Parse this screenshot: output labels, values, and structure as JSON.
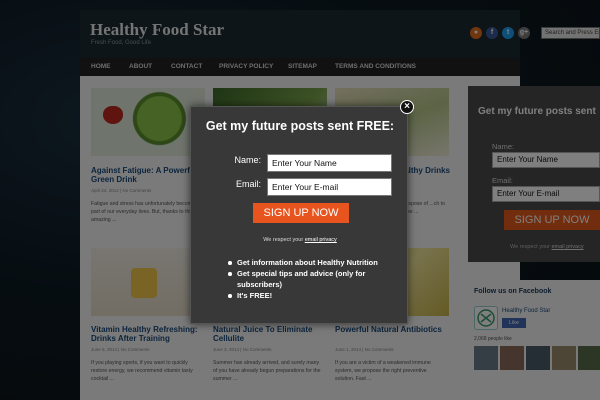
{
  "site": {
    "title": "Healthy Food Star",
    "tagline": "Fresh Food, Good Life",
    "search_placeholder": "Search and Press Enter",
    "social_icons": [
      {
        "name": "rss-icon",
        "glyph": "●",
        "color": "#e46c1e"
      },
      {
        "name": "facebook-icon",
        "glyph": "f",
        "color": "#3b5998"
      },
      {
        "name": "twitter-icon",
        "glyph": "t",
        "color": "#1da1f2"
      },
      {
        "name": "google-plus-icon",
        "glyph": "g+",
        "color": "#7a7a7a"
      }
    ]
  },
  "nav": {
    "items": [
      "HOME",
      "ABOUT",
      "CONTACT",
      "PRIVACY POLICY",
      "SITEMAP",
      "TERMS AND CONDITIONS"
    ]
  },
  "posts": [
    {
      "title": "Against Fatigue: A Powerful Green Drink",
      "meta": "April 24, 2014  |  No Comments",
      "excerpt": "Fatigue and stress has unfortunately become part of our everyday lives. But, thanks to this amazing ..."
    },
    {
      "title": "Natural Juice To Eliminate",
      "meta": "",
      "excerpt": ""
    },
    {
      "title": "Healthy Drinks",
      "meta": "",
      "excerpt": "...dispose of ...ch to make ..."
    },
    {
      "title": "Vitamin Healthy Refreshing: Drinks After Training",
      "meta": "June 5, 2014  |  No Comments",
      "excerpt": "If you playing sports, if you want to quickly restore energy, we recommend vitamin tasty cocktail ..."
    },
    {
      "title": "Natural Juice To Eliminate Cellulite",
      "meta": "June 3, 2014  |  No Comments",
      "excerpt": "Summer has already arrived, and surely many of you have already begun preparations for the summer ..."
    },
    {
      "title": "Powerful Natural Antibiotics",
      "meta": "June 1, 2014  |  No Comments",
      "excerpt": "If you are a victim of a weakened immune system, we propose the right preventive solution. Fast ..."
    }
  ],
  "sidebar": {
    "title": "Get my future posts sent",
    "name_label": "Name:",
    "name_placeholder": "Enter Your Name",
    "email_label": "Email:",
    "email_placeholder": "Enter Your E-mail",
    "button": "SIGN UP NOW",
    "note_prefix": "We respect your ",
    "note_link": "email privacy"
  },
  "facebook": {
    "title": "Follow us on Facebook",
    "page_name": "Healthy Food Star",
    "like_label": "Like",
    "count": "2,068 people like"
  },
  "popup": {
    "title": "Get my future posts sent FREE:",
    "close_glyph": "×",
    "name_label": "Name:",
    "name_placeholder": "Enter Your Name",
    "email_label": "Email:",
    "email_placeholder": "Enter Your E-mail",
    "button": "SIGN UP NOW",
    "note_prefix": "We respect your ",
    "note_link": "email privacy",
    "benefits": [
      "Get information about Healthy Nutrition",
      "Get special tips and advice (only for subscribers)",
      "It's FREE!"
    ]
  },
  "colors": {
    "accent": "#e8541e",
    "popup_bg": "#383838",
    "header_bg": "#1d2a32"
  }
}
